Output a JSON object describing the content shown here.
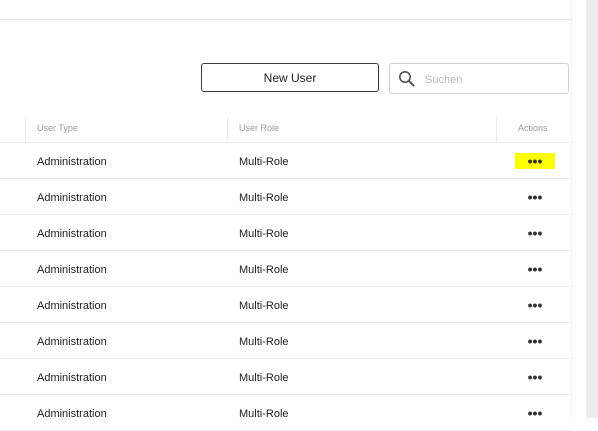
{
  "toolbar": {
    "new_user_label": "New User",
    "search_placeholder": "Suchen"
  },
  "table": {
    "columns": [
      "User Type",
      "User Role",
      "Actions"
    ],
    "rows": [
      {
        "user_type": "Administration",
        "user_role": "Multi-Role",
        "actions": "•••"
      },
      {
        "user_type": "Administration",
        "user_role": "Multi-Role",
        "actions": "•••"
      },
      {
        "user_type": "Administration",
        "user_role": "Multi-Role",
        "actions": "•••"
      },
      {
        "user_type": "Administration",
        "user_role": "Multi-Role",
        "actions": "•••"
      },
      {
        "user_type": "Administration",
        "user_role": "Multi-Role",
        "actions": "•••"
      },
      {
        "user_type": "Administration",
        "user_role": "Multi-Role",
        "actions": "•••"
      },
      {
        "user_type": "Administration",
        "user_role": "Multi-Role",
        "actions": "•••"
      },
      {
        "user_type": "Administration",
        "user_role": "Multi-Role",
        "actions": "•••"
      }
    ]
  },
  "colors": {
    "highlight": "#ffff00",
    "border_dark": "#3a3a3a",
    "header_text": "#9a9a9a"
  },
  "icons": {
    "search": "search-icon",
    "actions": "more-horizontal-icon"
  }
}
